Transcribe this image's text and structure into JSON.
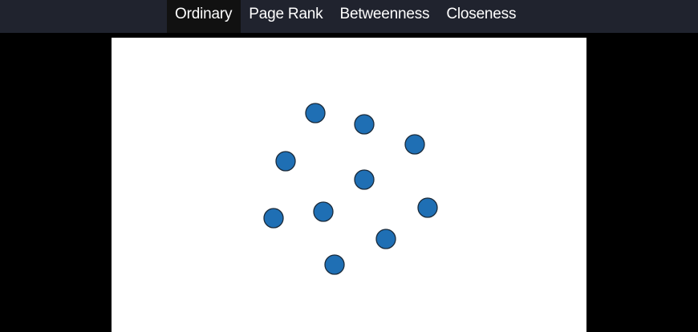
{
  "nav": {
    "tabs": [
      {
        "label": "Ordinary",
        "active": true
      },
      {
        "label": "Page Rank",
        "active": false
      },
      {
        "label": "Betweenness",
        "active": false
      },
      {
        "label": "Closeness",
        "active": false
      }
    ]
  },
  "graph": {
    "node_count": 10,
    "node_color": "#1f6fb4",
    "node_stroke": "#1a2a3a"
  },
  "colors": {
    "nav_background": "#20232e",
    "active_tab_background": "#111111",
    "page_background": "#000000",
    "canvas_background": "#ffffff"
  }
}
